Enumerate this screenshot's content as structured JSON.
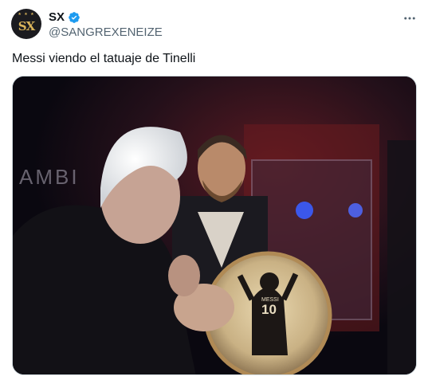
{
  "author": {
    "display_name": "SX",
    "handle": "@SANGREXENEIZE",
    "avatar_text": "SX",
    "avatar_stars": "★ ★ ★",
    "verified_color": "#1d9bf0"
  },
  "more_icon": "more-horizontal-icon",
  "tweet": {
    "text": "Messi viendo el tatuaje de Tinelli"
  },
  "media": {
    "background_letters": "AMBI",
    "jersey_number": "10",
    "jersey_name": "MESSI"
  },
  "colors": {
    "text_primary": "#0f1419",
    "text_secondary": "#536471",
    "border": "#cfd9de",
    "verified": "#1d9bf0"
  }
}
